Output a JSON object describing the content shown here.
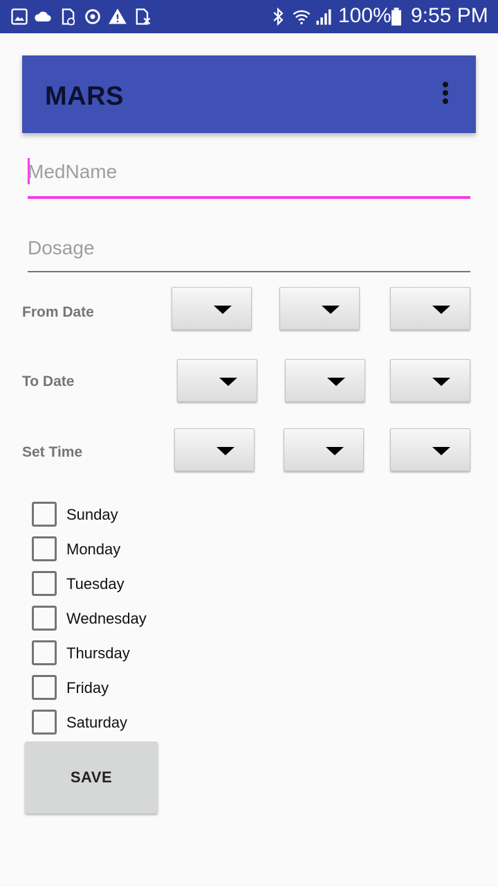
{
  "status_bar": {
    "icons_left": [
      "gallery-icon",
      "cloud-icon",
      "sd-card-icon",
      "sync-icon",
      "warning-icon",
      "no-sim-icon"
    ],
    "icons_right": [
      "bluetooth-icon",
      "wifi-icon",
      "signal-icon",
      "battery-icon"
    ],
    "battery": "100%",
    "time": "9:55 PM"
  },
  "app_bar": {
    "title": "MARS",
    "menu_icon": "overflow-menu-icon"
  },
  "form": {
    "med_name_placeholder": "MedName",
    "dosage_placeholder": "Dosage",
    "from_date_label": "From Date",
    "to_date_label": "To Date",
    "set_time_label": "Set Time",
    "days": [
      "Sunday",
      "Monday",
      "Tuesday",
      "Wednesday",
      "Thursday",
      "Friday",
      "Saturday"
    ],
    "save_label": "SAVE"
  },
  "colors": {
    "status_bar": "#2c3f9e",
    "app_bar": "#3f51b5",
    "accent": "#f53fe8"
  }
}
